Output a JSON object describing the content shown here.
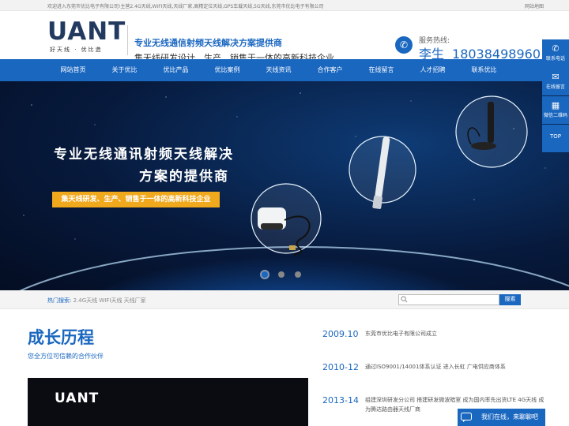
{
  "topbar": {
    "welcome": "欢迎进入东莞市优比电子有限公司!主营2.4G天线,WIFI天线,天线厂家,高精定位天线,GPS车载天线,5G天线,东莞市优比电子有限公司",
    "sitemap": "网站地图"
  },
  "header": {
    "logo_word": "UANT",
    "logo_slogan": "好天线 · 优比造",
    "line1": "专业无线通信射频天线解决方案提供商",
    "line2": "集天线研发设计、生产、销售于一体的高新科技企业",
    "hotline_label": "服务热线:",
    "hotline_name": "李生",
    "hotline_number": "18038498960"
  },
  "nav": [
    {
      "label": "网站首页"
    },
    {
      "label": "关于优比"
    },
    {
      "label": "优比产品"
    },
    {
      "label": "优比案例"
    },
    {
      "label": "天线资讯"
    },
    {
      "label": "合作客户"
    },
    {
      "label": "在线留言"
    },
    {
      "label": "人才招聘"
    },
    {
      "label": "联系优比"
    }
  ],
  "banner": {
    "heading1": "专业无线通讯射频天线解决",
    "heading2": "方案的提供商",
    "tagline": "集天线研发、生产、销售于一体的高新科技企业",
    "slide_count": 3,
    "active_slide": 1
  },
  "search": {
    "hot_label": "热门搜索:",
    "hot_terms": "2.4G天线  WIFI天线  天线厂家",
    "placeholder": "",
    "button": "搜索"
  },
  "growth": {
    "title": "成长历程",
    "subtitle": "您全方位可信赖的合作伙伴",
    "video_logo": "UANT"
  },
  "timeline": [
    {
      "year": "2009.10",
      "desc": "东莞市优比电子有限公司成立"
    },
    {
      "year": "2010-12",
      "desc": "通过ISO9001/14001体系认证 进入长虹 广电供应商体系"
    },
    {
      "year": "2013-14",
      "desc": "组建深圳研发分公司 搭建研发微波暗室 成为国内率先出货LTE 4G天线 成为腾达路由器天线厂商"
    }
  ],
  "side_float": {
    "contact": "联系电话",
    "message": "在线留言",
    "wechat": "微信二维码",
    "top": "TOP"
  },
  "chat": {
    "text": "我们在线，来聊聊吧"
  },
  "colors": {
    "brand_blue": "#1a67c0",
    "accent_orange": "#f0a81d"
  }
}
